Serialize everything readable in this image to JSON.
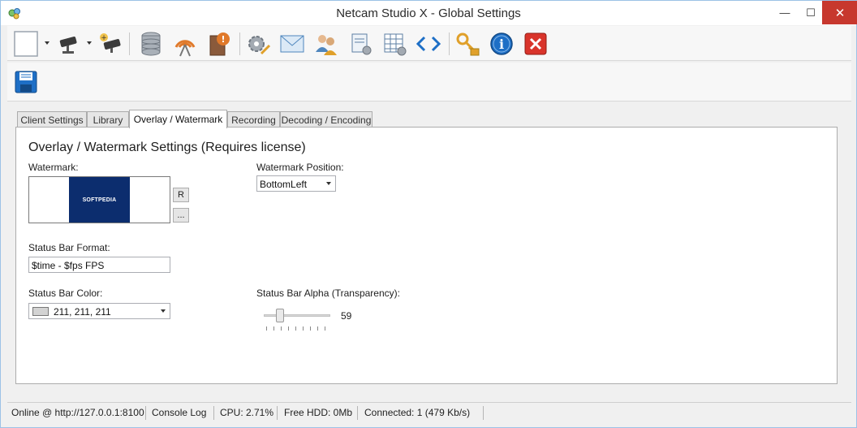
{
  "window": {
    "title": "Netcam Studio X - Global Settings",
    "minimize_glyph": "—",
    "maximize_glyph": "☐",
    "close_glyph": "✕"
  },
  "toolbar": {
    "icons": [
      "blank-page-icon",
      "camera-icon",
      "add-camera-icon",
      "database-icon",
      "broadcast-icon",
      "book-alert-icon",
      "gear-pencil-icon",
      "email-icon",
      "users-icon",
      "scroll-settings-icon",
      "table-settings-icon",
      "code-icon",
      "key-lock-icon",
      "info-icon",
      "close-red-icon"
    ]
  },
  "toolbar2": {
    "icons": [
      "save-icon"
    ]
  },
  "tabs": [
    {
      "label": "Client Settings"
    },
    {
      "label": "Library"
    },
    {
      "label": "Overlay / Watermark"
    },
    {
      "label": "Recording"
    },
    {
      "label": "Decoding / Encoding"
    }
  ],
  "active_tab": "Overlay / Watermark",
  "panel": {
    "heading": "Overlay / Watermark Settings (Requires license)",
    "watermark_label": "Watermark:",
    "watermark_logo_text": "SOFTPEDIA",
    "reset_button_label": "R",
    "browse_button_label": "...",
    "watermark_position_label": "Watermark Position:",
    "watermark_position_value": "BottomLeft",
    "status_bar_format_label": "Status Bar Format:",
    "status_bar_format_value": "$time - $fps FPS",
    "status_bar_color_label": "Status Bar Color:",
    "status_bar_color_value": "211, 211, 211",
    "status_bar_color_hex": "#d3d3d3",
    "status_bar_alpha_label": "Status Bar Alpha (Transparency):",
    "status_bar_alpha_value": "59"
  },
  "statusbar": {
    "online": "Online @ http://127.0.0.1:8100",
    "console_log": "Console Log",
    "cpu": "CPU: 2.71%",
    "free_hdd": "Free HDD: 0Mb",
    "connected": "Connected: 1 (479 Kb/s)"
  },
  "colors": {
    "close_button": "#c7382e",
    "logo_background": "#0c2d6e",
    "accent_blue": "#1e6fc6"
  }
}
